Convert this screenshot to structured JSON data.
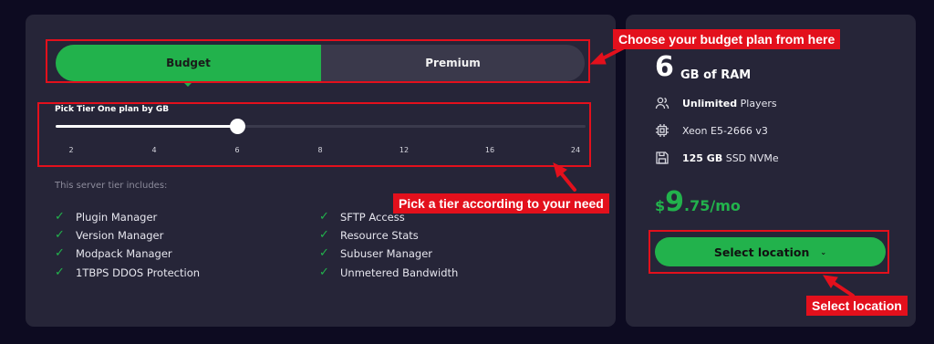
{
  "tabs": {
    "budget": "Budget",
    "premium": "Premium"
  },
  "slider": {
    "label": "Pick Tier One plan by GB",
    "ticks": [
      "2",
      "4",
      "6",
      "8",
      "12",
      "16",
      "24"
    ],
    "selected_index": 2
  },
  "includes": {
    "title": "This server tier includes:",
    "check_glyph": "✓",
    "left": [
      "Plugin Manager",
      "Version Manager",
      "Modpack Manager",
      "1TBPS DDOS Protection"
    ],
    "right": [
      "SFTP Access",
      "Resource Stats",
      "Subuser Manager",
      "Unmetered Bandwidth"
    ]
  },
  "plan": {
    "ram_value": "6",
    "ram_label": "GB of RAM",
    "players_bold": "Unlimited",
    "players_text": "Players",
    "cpu": "Xeon E5-2666 v3",
    "storage_bold": "125 GB",
    "storage_text": "SSD NVMe",
    "price_currency": "$",
    "price_int": "9",
    "price_dec": ".75/mo"
  },
  "button": {
    "select_label": "Select location",
    "chevron": "⌄"
  },
  "annotations": {
    "budget_plan": "Choose your budget plan from here",
    "tier": "Pick a tier according to your need",
    "location": "Select location"
  },
  "icons": {
    "players": "users-icon",
    "cpu": "cpu-chip-icon",
    "storage": "save-disk-icon"
  },
  "colors": {
    "accent": "#22b24c",
    "annotation": "#e3101c",
    "panel": "#262538",
    "background": "#0d0b21"
  }
}
